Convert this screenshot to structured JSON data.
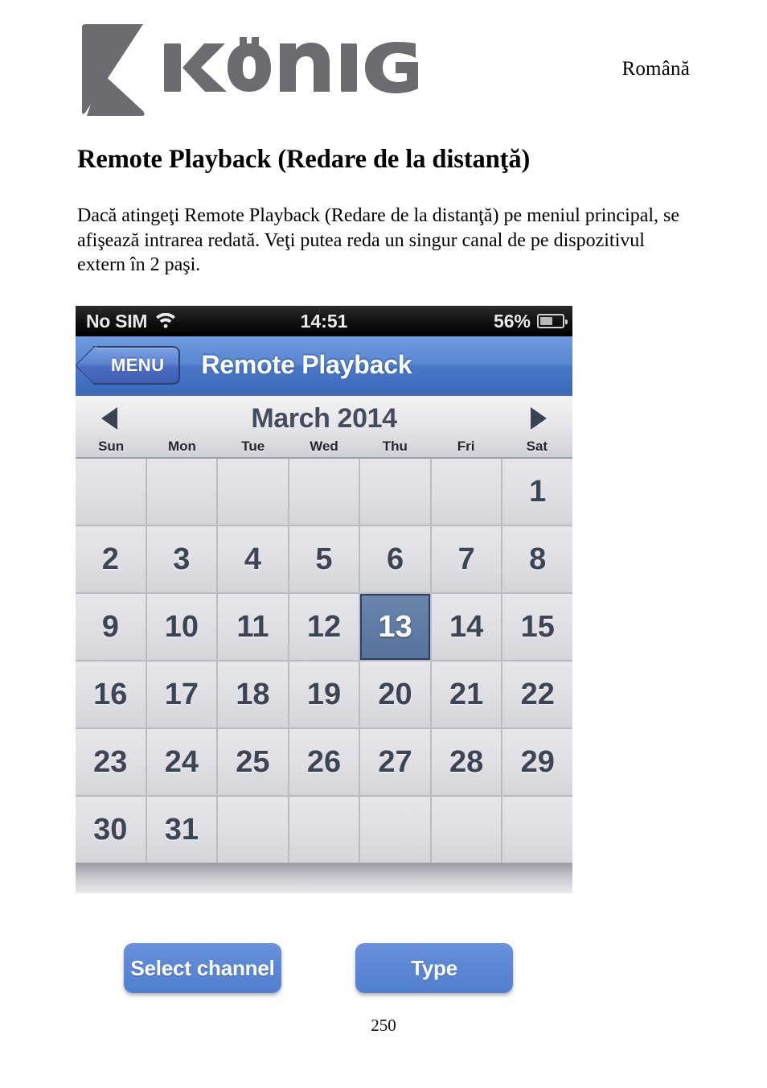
{
  "document": {
    "brand_name": "KÖNIG",
    "language_label": "Română",
    "page_number": "250",
    "title": "Remote Playback (Redare de la distanţă)",
    "body_text": "Dacă atingeţi Remote Playback (Redare de la distanţă) pe meniul principal, se afişează intrarea redată. Veţi putea reda un singur canal de pe dispozitivul extern în 2 paşi."
  },
  "phone": {
    "status_bar": {
      "carrier": "No SIM",
      "wifi_icon": "wifi-icon",
      "time": "14:51",
      "battery_percent": "56%",
      "battery_level": 56,
      "battery_icon": "battery-icon"
    },
    "nav_bar": {
      "back_label": "MENU",
      "title": "Remote Playback",
      "accent_color": "#5a87d2"
    },
    "calendar": {
      "prev_icon": "triangle-left-icon",
      "next_icon": "triangle-right-icon",
      "month_label": "March 2014",
      "weekdays": [
        "Sun",
        "Mon",
        "Tue",
        "Wed",
        "Thu",
        "Fri",
        "Sat"
      ],
      "selected_day": 13,
      "selected_color": "#5f7ba3",
      "weeks": [
        [
          "",
          "",
          "",
          "",
          "",
          "",
          "1"
        ],
        [
          "2",
          "3",
          "4",
          "5",
          "6",
          "7",
          "8"
        ],
        [
          "9",
          "10",
          "11",
          "12",
          "13",
          "14",
          "15"
        ],
        [
          "16",
          "17",
          "18",
          "19",
          "20",
          "21",
          "22"
        ],
        [
          "23",
          "24",
          "25",
          "26",
          "27",
          "28",
          "29"
        ],
        [
          "30",
          "31",
          "",
          "",
          "",
          "",
          ""
        ]
      ]
    }
  },
  "actions": {
    "select_channel_label": "Select channel",
    "type_label": "Type",
    "button_color": "#5a86d4"
  }
}
